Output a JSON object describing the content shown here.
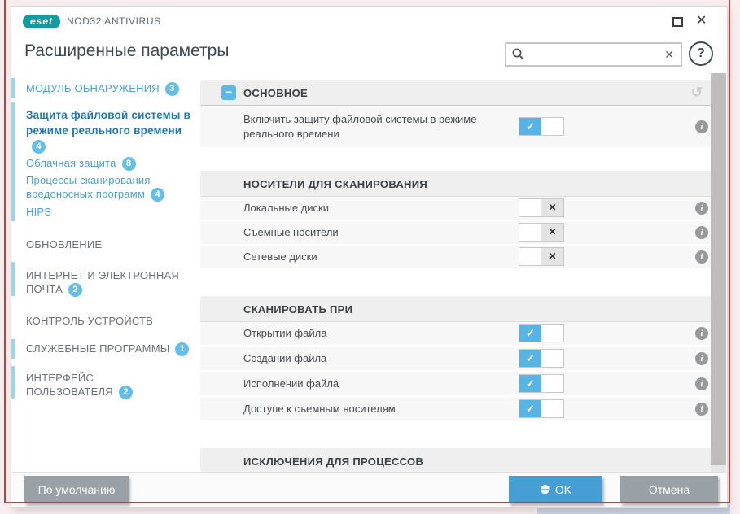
{
  "titlebar": {
    "logo_text": "eset",
    "product_name": "NOD32 ANTIVIRUS"
  },
  "header": {
    "title": "Расширенные параметры",
    "search_value": ""
  },
  "icons": {
    "check": "✓",
    "cross": "✕",
    "minus": "−",
    "undo": "↺",
    "info": "i",
    "help": "?",
    "close": "✕",
    "clear": "✕",
    "search": "magnifier",
    "shield": "uac-shield"
  },
  "colors": {
    "brand_teal": "#129ba1",
    "accent_blue": "#58b4e2",
    "selected_text_blue": "#2178b5",
    "sidebar_link_blue": "#4aa0d5",
    "ok_button_blue": "#459fd4",
    "gray_button": "#99a0a6",
    "badge_blue": "#64bfe8",
    "annotation_red": "#b2453e"
  },
  "sidebar": {
    "items": [
      {
        "label": "МОДУЛЬ ОБНАРУЖЕНИЯ",
        "badge": "3",
        "state": "active-section"
      },
      {
        "label": "Защита файловой системы в режиме реального времени",
        "badge": "4",
        "state": "selected"
      },
      {
        "label": "Облачная защита",
        "badge": "8",
        "state": "normal"
      },
      {
        "label": "Процессы сканирования вредоносных программ",
        "badge": "4",
        "state": "normal"
      },
      {
        "label": "HIPS",
        "state": "normal"
      },
      {
        "label": "ОБНОВЛЕНИЕ",
        "state": "normal"
      },
      {
        "label": "ИНТЕРНЕТ И ЭЛЕКТРОННАЯ ПОЧТА",
        "badge": "2",
        "state": "normal"
      },
      {
        "label": "КОНТРОЛЬ УСТРОЙСТВ",
        "state": "normal"
      },
      {
        "label": "СЛУЖЕБНЫЕ ПРОГРАММЫ",
        "badge": "1",
        "state": "normal"
      },
      {
        "label": "ИНТЕРФЕЙС ПОЛЬЗОВАТЕЛЯ",
        "badge": "2",
        "state": "normal"
      }
    ]
  },
  "content": {
    "sections": [
      {
        "title": "ОСНОВНОЕ",
        "collapsible": true,
        "rows": [
          {
            "label": "Включить защиту файловой системы в режиме реального времени",
            "toggle": "on"
          }
        ]
      },
      {
        "title": "НОСИТЕЛИ ДЛЯ СКАНИРОВАНИЯ",
        "rows": [
          {
            "label": "Локальные диски",
            "toggle": "off"
          },
          {
            "label": "Съемные носители",
            "toggle": "off"
          },
          {
            "label": "Сетевые диски",
            "toggle": "off"
          }
        ]
      },
      {
        "title": "СКАНИРОВАТЬ ПРИ",
        "rows": [
          {
            "label": "Открытии файла",
            "toggle": "on"
          },
          {
            "label": "Создании файла",
            "toggle": "on"
          },
          {
            "label": "Исполнении файла",
            "toggle": "on"
          },
          {
            "label": "Доступе к съемным носителям",
            "toggle": "on"
          }
        ]
      },
      {
        "title": "ИСКЛЮЧЕНИЯ ДЛЯ ПРОЦЕССОВ",
        "rows": []
      }
    ]
  },
  "footer": {
    "default_label": "По умолчанию",
    "ok_label": "OK",
    "cancel_label": "Отмена"
  }
}
